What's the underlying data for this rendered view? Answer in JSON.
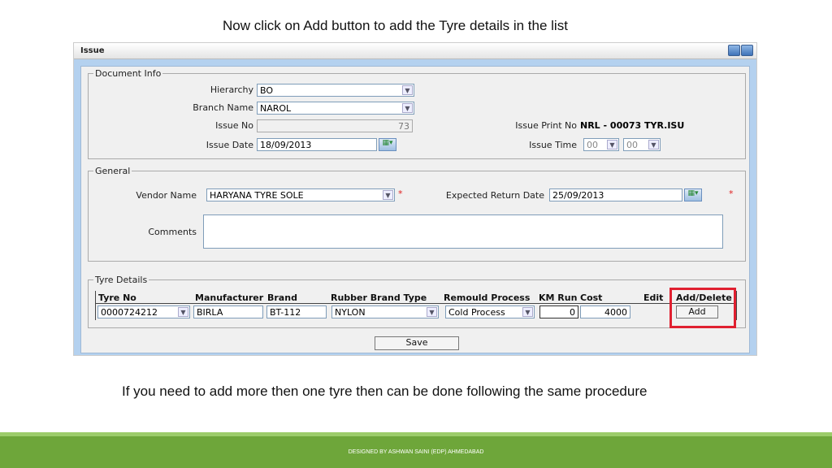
{
  "instruction_top": "Now click on Add button to add the Tyre details in the list",
  "instruction_bottom": "If you need to add more then one tyre then can be done following the same procedure",
  "footer": "DESIGNED BY ASHWAN SAINI (EDP) AHMEDABAD",
  "window": {
    "title": "Issue"
  },
  "document_info": {
    "legend": "Document Info",
    "hierarchy_label": "Hierarchy",
    "hierarchy": "BO",
    "branch_label": "Branch Name",
    "branch": "NAROL",
    "issue_no_label": "Issue No",
    "issue_no": "73",
    "issue_date_label": "Issue Date",
    "issue_date": "18/09/2013",
    "print_no_label": "Issue Print No",
    "print_no": "NRL - 00073 TYR.ISU",
    "issue_time_label": "Issue Time",
    "hour": "00",
    "minute": "00"
  },
  "general": {
    "legend": "General",
    "vendor_label": "Vendor Name",
    "vendor": "HARYANA TYRE SOLE",
    "return_label": "Expected Return Date",
    "return_date": "25/09/2013",
    "comments_label": "Comments",
    "required": "*"
  },
  "tyre": {
    "legend": "Tyre Details",
    "headers": [
      "Tyre No",
      "Manufacturer",
      "Brand",
      "Rubber Brand Type",
      "Remould Process",
      "KM Run",
      "Cost",
      "Edit",
      "Add/Delete"
    ],
    "row": {
      "tyre_no": "0000724212",
      "manufacturer": "BIRLA",
      "brand": "BT-112",
      "rubber": "NYLON",
      "process": "Cold Process",
      "km": "0",
      "cost": "4000",
      "add": "Add"
    }
  },
  "save": "Save",
  "highlight_color": "#e02030"
}
